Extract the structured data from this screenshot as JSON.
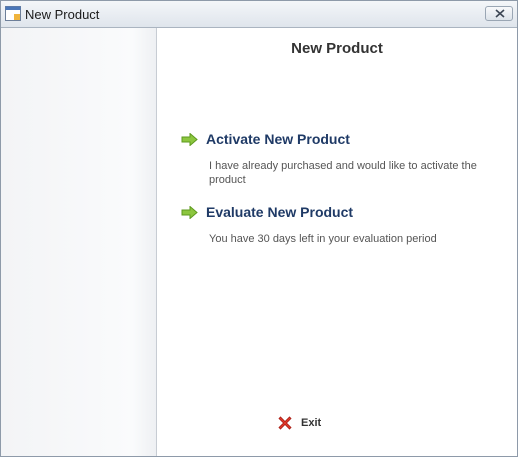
{
  "window": {
    "title": "New Product"
  },
  "main": {
    "heading": "New Product",
    "options": [
      {
        "label": "Activate New Product",
        "description": "I have already purchased and would like to activate the product",
        "icon": "green-arrow-icon"
      },
      {
        "label": "Evaluate New Product",
        "description": "You have 30 days left in your evaluation period",
        "icon": "green-arrow-icon"
      }
    ],
    "exit": {
      "label": "Exit",
      "icon": "red-x-icon"
    }
  },
  "colors": {
    "accent_arrow": "#8cc63f",
    "title_text": "#1f3a66",
    "exit_x": "#e23a2a"
  }
}
